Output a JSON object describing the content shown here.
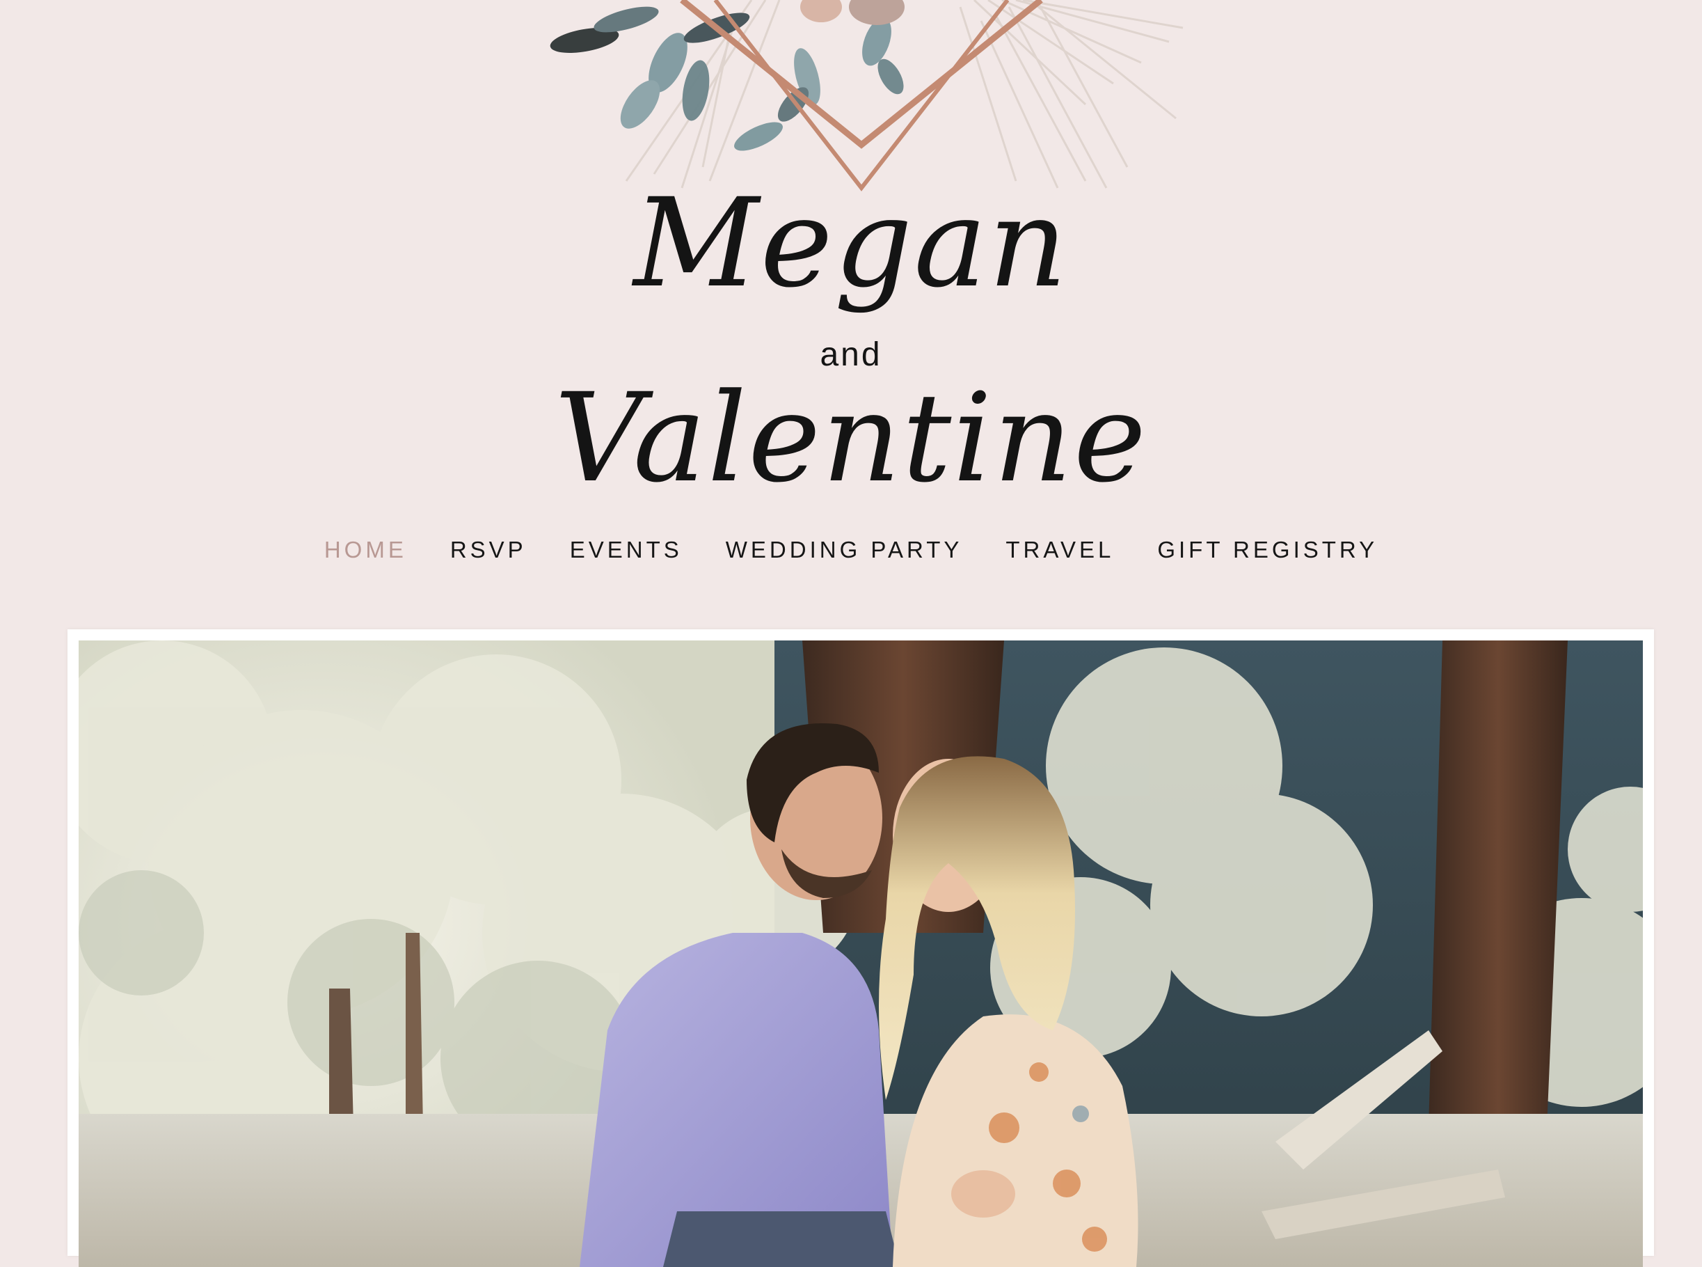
{
  "couple": {
    "first_name": "Megan",
    "conjunction": "and",
    "second_name": "Valentine"
  },
  "nav": {
    "items": [
      {
        "label": "HOME",
        "active": true
      },
      {
        "label": "RSVP",
        "active": false
      },
      {
        "label": "EVENTS",
        "active": false
      },
      {
        "label": "WEDDING PARTY",
        "active": false
      },
      {
        "label": "TRAVEL",
        "active": false
      },
      {
        "label": "GIFT REGISTRY",
        "active": false
      }
    ]
  },
  "colors": {
    "background": "#f2e8e7",
    "active_nav": "#b89893",
    "text": "#141414",
    "rose_gold": "#c48a72"
  },
  "hero": {
    "image_description_icon": "couple-photo"
  }
}
